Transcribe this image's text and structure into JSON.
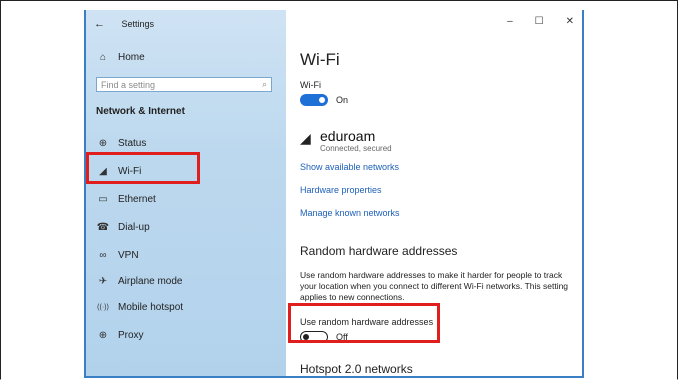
{
  "window": {
    "title": "Settings",
    "controls": {
      "minimize": "–",
      "maximize": "☐",
      "close": "✕"
    }
  },
  "sidebar": {
    "home": "Home",
    "search_placeholder": "Find a setting",
    "section_title": "Network & Internet",
    "items": [
      {
        "label": "Status",
        "icon": "status-icon",
        "glyph": "⊕"
      },
      {
        "label": "Wi-Fi",
        "icon": "wifi-icon",
        "glyph": "◢"
      },
      {
        "label": "Ethernet",
        "icon": "ethernet-icon",
        "glyph": "▭"
      },
      {
        "label": "Dial-up",
        "icon": "dialup-icon",
        "glyph": "☎"
      },
      {
        "label": "VPN",
        "icon": "vpn-icon",
        "glyph": "∞"
      },
      {
        "label": "Airplane mode",
        "icon": "airplane-icon",
        "glyph": "✈"
      },
      {
        "label": "Mobile hotspot",
        "icon": "hotspot-icon",
        "glyph": "((·))"
      },
      {
        "label": "Proxy",
        "icon": "proxy-icon",
        "glyph": "⊕"
      }
    ]
  },
  "main": {
    "title": "Wi-Fi",
    "wifi_label": "Wi-Fi",
    "wifi_state": "On",
    "network_name": "eduroam",
    "network_status": "Connected, secured",
    "links": [
      "Show available networks",
      "Hardware properties",
      "Manage known networks"
    ],
    "random_hw_title": "Random hardware addresses",
    "random_hw_desc": "Use random hardware addresses to make it harder for people to track your location when you connect to different Wi-Fi networks. This setting applies to new connections.",
    "random_hw_label": "Use random hardware addresses",
    "random_hw_state": "Off",
    "hotspot_title": "Hotspot 2.0 networks"
  },
  "colors": {
    "accent": "#1e6fd6",
    "highlight": "#e01e1e",
    "sidebar_bg": "#c4dcf0"
  }
}
